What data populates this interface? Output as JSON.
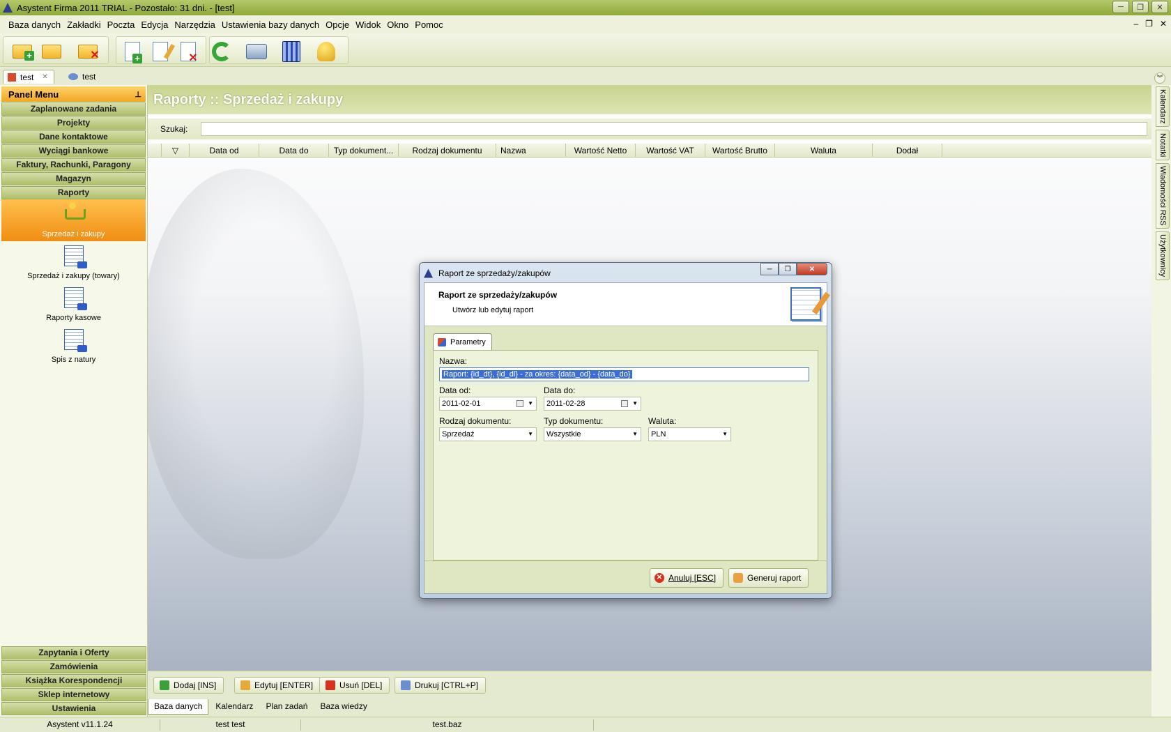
{
  "window": {
    "title": "Asystent Firma 2011 TRIAL - Pozostało: 31 dni. - [test]",
    "buttons": [
      "─",
      "❐",
      "✕"
    ]
  },
  "menu": [
    "Baza danych",
    "Zakładki",
    "Poczta",
    "Edycja",
    "Narzędzia",
    "Ustawienia bazy danych",
    "Opcje",
    "Widok",
    "Okno",
    "Pomoc"
  ],
  "mdi_buttons": [
    "–",
    "❐",
    "✕"
  ],
  "doc_tabs": [
    {
      "label": "test",
      "active": true
    },
    {
      "label": "test",
      "active": false
    }
  ],
  "panel": {
    "title": "Panel Menu",
    "pin": "⊥",
    "categories": [
      "Zaplanowane zadania",
      "Projekty",
      "Dane kontaktowe",
      "Wyciągi bankowe",
      "Faktury, Rachunki, Paragony",
      "Magazyn",
      "Raporty"
    ],
    "sub_items": [
      {
        "label": "Sprzedaż i zakupy",
        "active": true
      },
      {
        "label": "Sprzedaż i zakupy (towary)",
        "active": false
      },
      {
        "label": "Raporty kasowe",
        "active": false
      },
      {
        "label": "Spis z natury",
        "active": false
      }
    ],
    "bottom_categories": [
      "Zapytania i Oferty",
      "Zamówienia",
      "Książka Korespondencji",
      "Sklep internetowy",
      "Ustawienia"
    ]
  },
  "main": {
    "title": "Raporty :: Sprzedaż i zakupy",
    "search_label": "Szukaj:",
    "search_value": "",
    "filter_glyph": "▽",
    "columns": [
      "Data od",
      "Data do",
      "Typ dokument...",
      "Rodzaj dokumentu",
      "Nazwa",
      "Wartość Netto",
      "Wartość VAT",
      "Wartość Brutto",
      "Waluta",
      "Dodał"
    ]
  },
  "actions": [
    "Dodaj [INS]",
    "Edytuj [ENTER]",
    "Usuń [DEL]",
    "Drukuj [CTRL+P]"
  ],
  "bottom_tabs": [
    {
      "label": "Baza danych",
      "active": true
    },
    {
      "label": "Kalendarz",
      "active": false
    },
    {
      "label": "Plan zadań",
      "active": false
    },
    {
      "label": "Baza wiedzy",
      "active": false
    }
  ],
  "status": [
    "Asystent v11.1.24",
    "test test",
    "test.baz",
    ""
  ],
  "right_tabs": [
    "Kalendarz",
    "Notatki",
    "Wiadomości RSS",
    "Użytkownicy"
  ],
  "collapse_glyph": "︾",
  "dialog": {
    "title": "Raport ze sprzedaży/zakupów",
    "header_title": "Raport ze sprzedaży/zakupów",
    "header_subtitle": "Utwórz lub edytuj raport",
    "tab": "Parametry",
    "fields": {
      "nazwa_label": "Nazwa:",
      "nazwa_value": "Raport: {id_dt}, {id_dl} - za okres: {data_od}  - {data_do}",
      "data_od_label": "Data od:",
      "data_od_value": "2011-02-01",
      "data_do_label": "Data do:",
      "data_do_value": "2011-02-28",
      "rodzaj_label": "Rodzaj dokumentu:",
      "rodzaj_value": "Sprzedaż",
      "typ_label": "Typ dokumentu:",
      "typ_value": "Wszystkie",
      "waluta_label": "Waluta:",
      "waluta_value": "PLN"
    },
    "cancel": "Anuluj [ESC]",
    "generate": "Generuj raport",
    "cancel_glyph": "✕"
  },
  "colors": {
    "accent_orange": "#f0a624",
    "theme_green": "#aebf6c"
  }
}
